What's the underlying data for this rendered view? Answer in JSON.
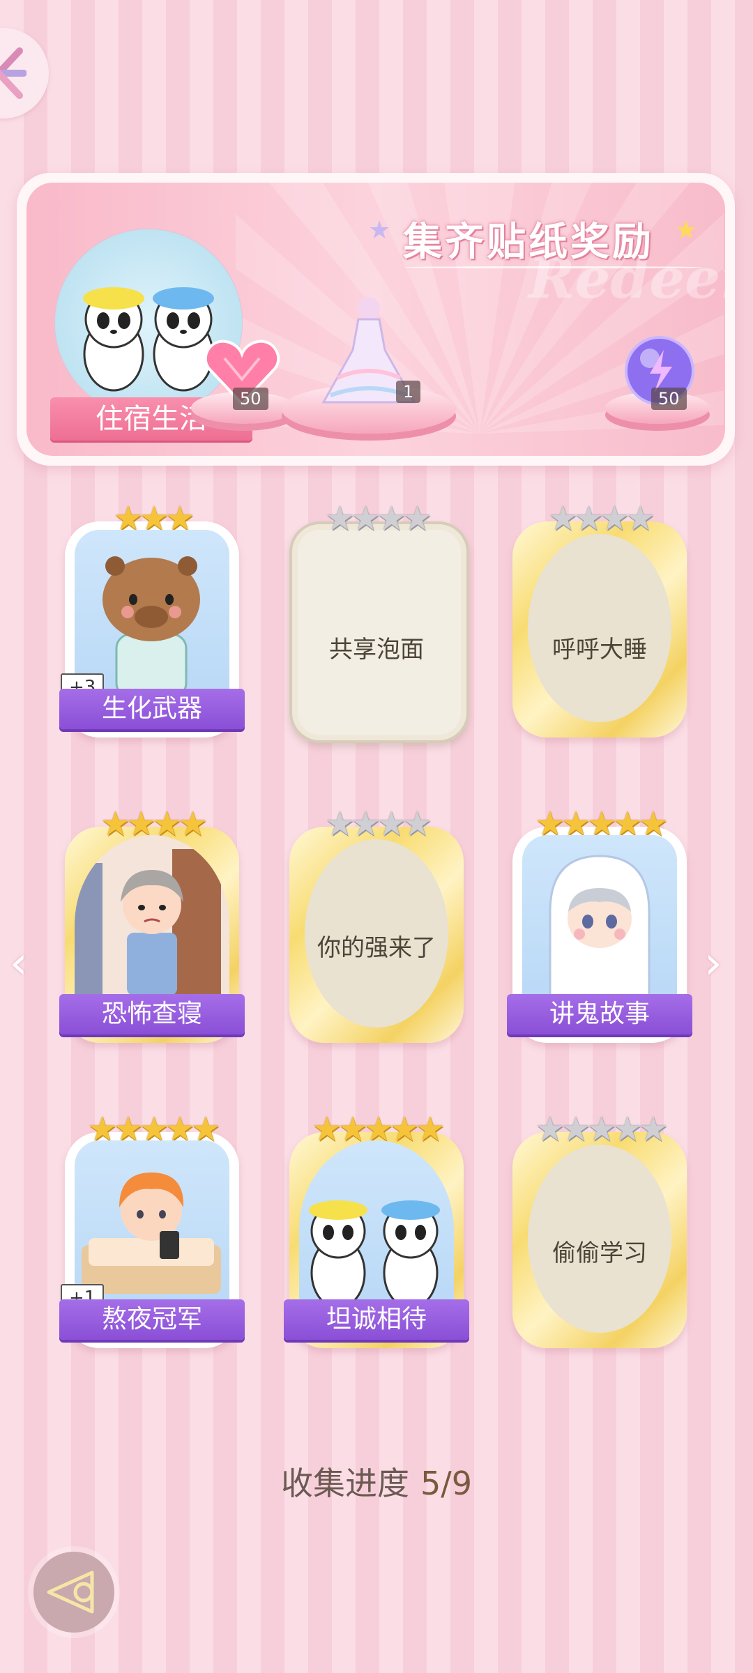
{
  "banner": {
    "title": "集齐贴纸奖励",
    "watermark": "Redeem",
    "category_label": "住宿生活",
    "rewards": [
      {
        "icon": "pink-heart-gem-icon",
        "count": "50"
      },
      {
        "icon": "dress-outfit-icon",
        "count": "1"
      },
      {
        "icon": "purple-energy-orb-icon",
        "count": "50"
      }
    ]
  },
  "cards": [
    {
      "title": "生化武器",
      "stars": 3,
      "max_stars": 3,
      "collected": true,
      "bonus": "+3",
      "art": "capybara-in-pajamas"
    },
    {
      "title": "共享泡面",
      "stars": 0,
      "max_stars": 4,
      "collected": false,
      "art": ""
    },
    {
      "title": "呼呼大睡",
      "stars": 0,
      "max_stars": 4,
      "collected": false,
      "art": ""
    },
    {
      "title": "恐怖查寝",
      "stars": 4,
      "max_stars": 4,
      "collected": true,
      "bonus": "",
      "art": "dorm-supervisor-lady"
    },
    {
      "title": "你的强来了",
      "stars": 0,
      "max_stars": 4,
      "collected": false,
      "art": ""
    },
    {
      "title": "讲鬼故事",
      "stars": 5,
      "max_stars": 5,
      "collected": true,
      "bonus": "",
      "art": "ghost-costume-boy"
    },
    {
      "title": "熬夜冠军",
      "stars": 5,
      "max_stars": 5,
      "collected": true,
      "bonus": "+1",
      "art": "boy-in-bed-with-phone"
    },
    {
      "title": "坦诚相待",
      "stars": 5,
      "max_stars": 5,
      "collected": true,
      "bonus": "",
      "art": "two-pandas-bathing"
    },
    {
      "title": "偷偷学习",
      "stars": 0,
      "max_stars": 5,
      "collected": false,
      "art": ""
    }
  ],
  "progress": {
    "label": "收集进度",
    "value": "5/9"
  },
  "colors": {
    "accent_purple": "#8a4fd6",
    "accent_pink": "#ee6f93",
    "star_gold": "#f6c43a"
  }
}
